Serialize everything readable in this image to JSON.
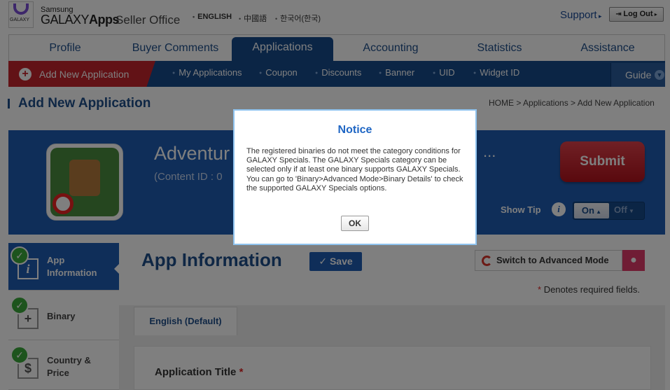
{
  "header": {
    "logo_text": "GALAXY",
    "brand_small": "Samsung",
    "brand_big_light": "GALAXY",
    "brand_big_bold": "Apps",
    "brand_office": "Seller Office",
    "languages": [
      "ENGLISH",
      "中國語",
      "한국어(한국)"
    ],
    "support": "Support",
    "logout": "Log Out"
  },
  "tabs": [
    "Profile",
    "Buyer Comments",
    "Applications",
    "Accounting",
    "Statistics",
    "Assistance"
  ],
  "active_tab": "Applications",
  "subnav": {
    "add_app": "Add New Application",
    "items": [
      "My Applications",
      "Coupon",
      "Discounts",
      "Banner",
      "UID",
      "Widget ID"
    ],
    "guide": "Guide"
  },
  "page": {
    "title": "Add New Application",
    "breadcrumb": "HOME > Applications > Add New Application"
  },
  "banner": {
    "app_name": "Adventur",
    "ellipsis": "...",
    "content_id": "(Content ID : 0",
    "submit": "Submit",
    "show_tip": "Show Tip",
    "tip_icon": "i",
    "toggle_on": "On",
    "toggle_off": "Off"
  },
  "sidebar": [
    {
      "label": "App Information",
      "line1": "App",
      "line2": "Information",
      "icon": "info-icon",
      "glyph": "i",
      "done": true,
      "active": true
    },
    {
      "label": "Binary",
      "line1": "Binary",
      "line2": "",
      "icon": "binary-icon",
      "glyph": "+",
      "done": true,
      "active": false
    },
    {
      "label": "Country & Price",
      "line1": "Country &",
      "line2": "Price",
      "icon": "price-icon",
      "glyph": "$",
      "done": true,
      "active": false
    }
  ],
  "main": {
    "section_title": "App Information",
    "save": "Save",
    "switch_mode": "Switch to Advanced Mode",
    "required_note": "Denotes required fields.",
    "lang_tab": "English (Default)",
    "field_label": "Application Title"
  },
  "modal": {
    "title": "Notice",
    "body": "The registered binaries do not meet the category conditions for GALAXY Specials. The GALAXY Specials category can be selected only if at least one binary supports GALAXY Specials. You can go to 'Binary>Advanced Mode>Binary Details' to check the supported GALAXY Specials options.",
    "ok": "OK"
  },
  "colors": {
    "brand_blue": "#174a8b",
    "banner_blue": "#1f5db2",
    "accent_red": "#c5242d",
    "check_green": "#3aa83a",
    "modal_border": "#8fc3ef"
  }
}
